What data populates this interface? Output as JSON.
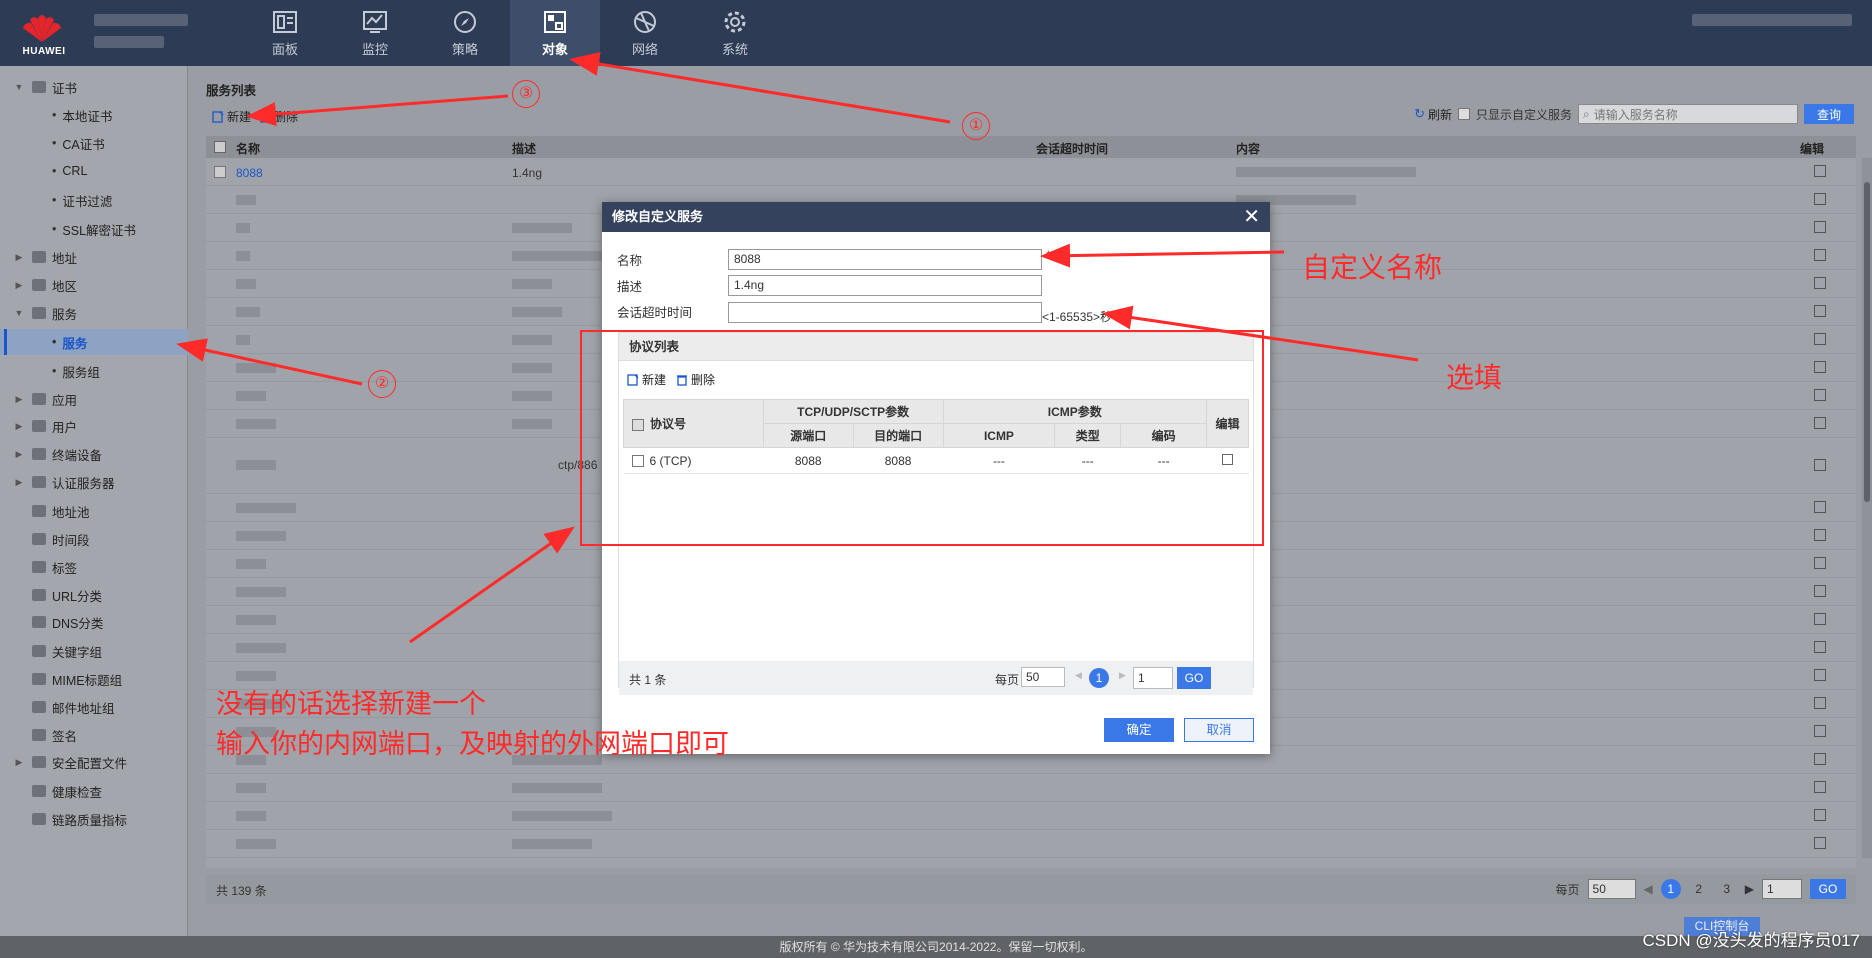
{
  "brand": {
    "name": "HUAWEI"
  },
  "nav": {
    "items": [
      {
        "label": "面板",
        "icon": "dashboard-icon"
      },
      {
        "label": "监控",
        "icon": "monitor-icon"
      },
      {
        "label": "策略",
        "icon": "compass-icon"
      },
      {
        "label": "对象",
        "icon": "object-icon"
      },
      {
        "label": "网络",
        "icon": "network-icon"
      },
      {
        "label": "系统",
        "icon": "gear-icon"
      }
    ],
    "active": "对象"
  },
  "sidebar": {
    "items": [
      {
        "label": "证书",
        "level": 0,
        "expanded": true
      },
      {
        "label": "本地证书",
        "level": 1
      },
      {
        "label": "CA证书",
        "level": 1
      },
      {
        "label": "CRL",
        "level": 1
      },
      {
        "label": "证书过滤",
        "level": 1
      },
      {
        "label": "SSL解密证书",
        "level": 1
      },
      {
        "label": "地址",
        "level": 0
      },
      {
        "label": "地区",
        "level": 0
      },
      {
        "label": "服务",
        "level": 0,
        "expanded": true
      },
      {
        "label": "服务",
        "level": 1,
        "selected": true
      },
      {
        "label": "服务组",
        "level": 1
      },
      {
        "label": "应用",
        "level": 0
      },
      {
        "label": "用户",
        "level": 0
      },
      {
        "label": "终端设备",
        "level": 0
      },
      {
        "label": "认证服务器",
        "level": 0
      },
      {
        "label": "地址池",
        "level": 0
      },
      {
        "label": "时间段",
        "level": 0
      },
      {
        "label": "标签",
        "level": 0
      },
      {
        "label": "URL分类",
        "level": 0
      },
      {
        "label": "DNS分类",
        "level": 0
      },
      {
        "label": "关键字组",
        "level": 0
      },
      {
        "label": "MIME标题组",
        "level": 0
      },
      {
        "label": "邮件地址组",
        "level": 0
      },
      {
        "label": "签名",
        "level": 0
      },
      {
        "label": "安全配置文件",
        "level": 0
      },
      {
        "label": "健康检查",
        "level": 0
      },
      {
        "label": "链路质量指标",
        "level": 0
      }
    ]
  },
  "main": {
    "title": "服务列表",
    "toolbar": {
      "new": "新建",
      "delete": "删除",
      "refresh": "刷新",
      "custom_only": "只显示自定义服务",
      "search_placeholder": "请输入服务名称",
      "query": "查询"
    },
    "columns": {
      "name": "名称",
      "desc": "描述",
      "timeout": "会话超时时间",
      "content": "内容",
      "edit": "编辑"
    },
    "first_row": {
      "name": "8088",
      "desc": "1.4ng"
    },
    "partial_text": "ctp/886",
    "footer": {
      "total": "共 139 条",
      "per_page_label": "每页",
      "per_page": "50",
      "pages": [
        "1",
        "2",
        "3"
      ],
      "page_input": "1",
      "go": "GO"
    }
  },
  "dialog": {
    "title": "修改自定义服务",
    "name_label": "名称",
    "name_value": "8088",
    "required_mark": "*",
    "desc_label": "描述",
    "desc_value": "1.4ng",
    "timeout_label": "会话超时时间",
    "timeout_value": "",
    "timeout_hint": "<1-65535>秒",
    "proto_panel": {
      "title": "协议列表",
      "new": "新建",
      "delete": "删除",
      "headers": {
        "protocol": "协议号",
        "tcp_group": "TCP/UDP/SCTP参数",
        "src_port": "源端口",
        "dst_port": "目的端口",
        "icmp_group": "ICMP参数",
        "icmp": "ICMP",
        "type": "类型",
        "code": "编码",
        "edit": "编辑"
      },
      "rows": [
        {
          "protocol": "6 (TCP)",
          "src_port": "8088",
          "dst_port": "8088",
          "icmp": "---",
          "type": "---",
          "code": "---"
        }
      ],
      "footer": {
        "total": "共 1 条",
        "per_page_label": "每页",
        "per_page": "50",
        "page": "1",
        "page_input": "1",
        "go": "GO"
      }
    },
    "ok": "确定",
    "cancel": "取消"
  },
  "annotations": {
    "n1": "①",
    "n2": "②",
    "n3": "③",
    "custom_name": "自定义名称",
    "optional": "选填",
    "note_line1": "没有的话选择新建一个",
    "note_line2": "输入你的内网端口，及映射的外网端口即可"
  },
  "footer": {
    "copyright": "版权所有 © 华为技术有限公司2014-2022。保留一切权利。",
    "cli": "CLI控制台"
  },
  "watermark": "CSDN @没头发的程序员017",
  "colors": {
    "nav_bg": "#2d3b54",
    "accent": "#3b78e7",
    "annotation": "#ff2a2a"
  }
}
